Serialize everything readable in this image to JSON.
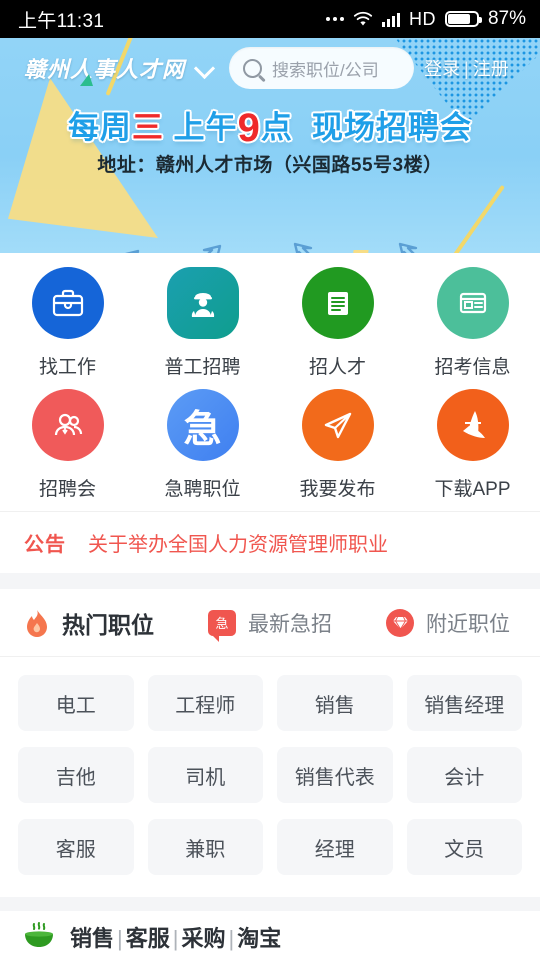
{
  "status_bar": {
    "time": "上午11:31",
    "network_label": "HD",
    "battery_percent": "87%",
    "battery_level": 87,
    "icons": [
      "more-dots-icon",
      "wifi-icon",
      "signal-icon",
      "battery-icon"
    ]
  },
  "header": {
    "logo_text": "赣州人事人才网",
    "dropdown_icon": "chevron-down-icon",
    "search": {
      "icon": "search-icon",
      "placeholder": "搜索职位/公司",
      "value": ""
    },
    "login_label": "登录",
    "divider": "|",
    "register_label": "注册"
  },
  "banner": {
    "headline_parts": [
      {
        "text": "每周",
        "color": "#1f9fe8"
      },
      {
        "text": "三",
        "color": "#ef2a2a"
      },
      {
        "text": " 上午",
        "color": "#1f9fe8"
      },
      {
        "text": "9",
        "color": "#ef2a2a",
        "big": true
      },
      {
        "text": "点  现场招聘会",
        "color": "#1f9fe8"
      }
    ],
    "headline_plain": "每周三 上午9点 现场招聘会",
    "address": "地址：赣州人才市场（兴国路55号3楼）",
    "bg_color": "#8fd2f5",
    "accent_blue": "#1f9fe8",
    "accent_red": "#ef2a2a",
    "accent_yellow": "#f7dd86"
  },
  "nav_grid": [
    {
      "label": "找工作",
      "icon": "briefcase-icon",
      "color": "#1565d8",
      "shape": "circle"
    },
    {
      "label": "普工招聘",
      "icon": "worker-icon",
      "color": "#17a2a0",
      "shape": "rounded-square"
    },
    {
      "label": "招人才",
      "icon": "document-icon",
      "color": "#219a21",
      "shape": "circle"
    },
    {
      "label": "招考信息",
      "icon": "news-card-icon",
      "color": "#4cbf9a",
      "shape": "circle"
    },
    {
      "label": "招聘会",
      "icon": "people-icon",
      "color": "#f05a5a",
      "shape": "circle"
    },
    {
      "label": "急聘职位",
      "icon": "urgent-ji-icon",
      "color": "#4a90f0",
      "shape": "circle"
    },
    {
      "label": "我要发布",
      "icon": "paper-plane-icon",
      "color": "#f26a1b",
      "shape": "circle"
    },
    {
      "label": "下载APP",
      "icon": "sail-app-icon",
      "color": "#f2601b",
      "shape": "circle"
    }
  ],
  "notice": {
    "tag": "公告",
    "text": "关于举办全国人力资源管理师职业",
    "color": "#f0564f"
  },
  "tabs": [
    {
      "label": "热门职位",
      "icon": "flame-icon",
      "active": true
    },
    {
      "label": "最新急招",
      "icon": "urgent-bubble-icon",
      "badge_char": "急",
      "active": false
    },
    {
      "label": "附近职位",
      "icon": "diamond-icon",
      "active": false
    }
  ],
  "job_tags": [
    "电工",
    "工程师",
    "销售",
    "销售经理",
    "吉他",
    "司机",
    "销售代表",
    "会计",
    "客服",
    "兼职",
    "经理",
    "文员"
  ],
  "bottom_row": {
    "icon": "bowl-icon",
    "icon_color": "#2e9a21",
    "items": [
      "销售",
      "客服",
      "采购",
      "淘宝"
    ],
    "separator": "|",
    "text": "销售 | 客服 | 采购 | 淘宝"
  }
}
